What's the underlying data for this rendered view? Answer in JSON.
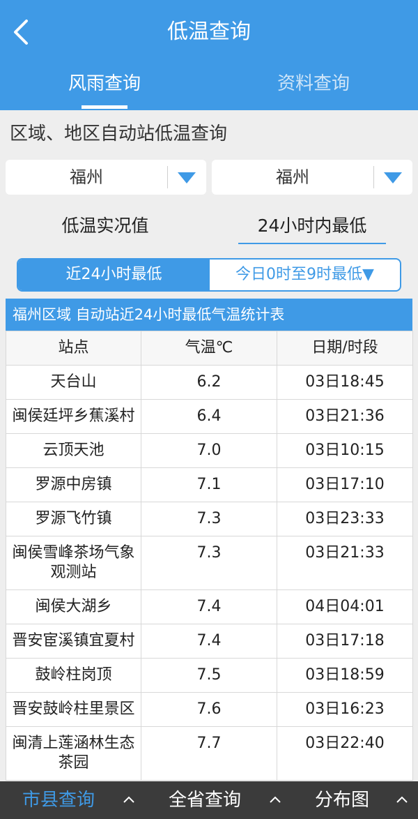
{
  "header": {
    "title": "低温查询",
    "tabs": [
      {
        "label": "风雨查询"
      },
      {
        "label": "资料查询"
      }
    ]
  },
  "section": {
    "title": "区域、地区自动站低温查询"
  },
  "filters": [
    {
      "value": "福州"
    },
    {
      "value": "福州"
    }
  ],
  "modes": [
    {
      "label": "低温实况值"
    },
    {
      "label": "24小时内最低"
    }
  ],
  "segments": [
    {
      "label": "近24小时最低"
    },
    {
      "label": "今日0时至9时最低▼"
    }
  ],
  "table": {
    "title": "福州区域 自动站近24小时最低气温统计表",
    "headers": [
      "站点",
      "气温℃",
      "日期/时段"
    ],
    "rows": [
      {
        "station": "天台山",
        "temp": "6.2",
        "time": "03日18:45"
      },
      {
        "station": "闽侯廷坪乡蕉溪村",
        "temp": "6.4",
        "time": "03日21:36"
      },
      {
        "station": "云顶天池",
        "temp": "7.0",
        "time": "03日10:15"
      },
      {
        "station": "罗源中房镇",
        "temp": "7.1",
        "time": "03日17:10"
      },
      {
        "station": "罗源飞竹镇",
        "temp": "7.3",
        "time": "03日23:33"
      },
      {
        "station": "闽侯雪峰茶场气象观测站",
        "temp": "7.3",
        "time": "03日21:33"
      },
      {
        "station": "闽侯大湖乡",
        "temp": "7.4",
        "time": "04日04:01"
      },
      {
        "station": "晋安宦溪镇宜夏村",
        "temp": "7.4",
        "time": "03日17:18"
      },
      {
        "station": "鼓岭柱岗顶",
        "temp": "7.5",
        "time": "03日18:59"
      },
      {
        "station": "晋安鼓岭柱里景区",
        "temp": "7.6",
        "time": "03日16:23"
      },
      {
        "station": "闽清上莲涵林生态茶园",
        "temp": "7.7",
        "time": "03日22:40"
      }
    ]
  },
  "bottom_nav": [
    {
      "label": "市县查询"
    },
    {
      "label": "全省查询"
    },
    {
      "label": "分布图"
    }
  ],
  "colors": {
    "primary": "#3f9ae6",
    "nav_bg": "#3b3b3b",
    "page_bg": "#eeeeee"
  }
}
